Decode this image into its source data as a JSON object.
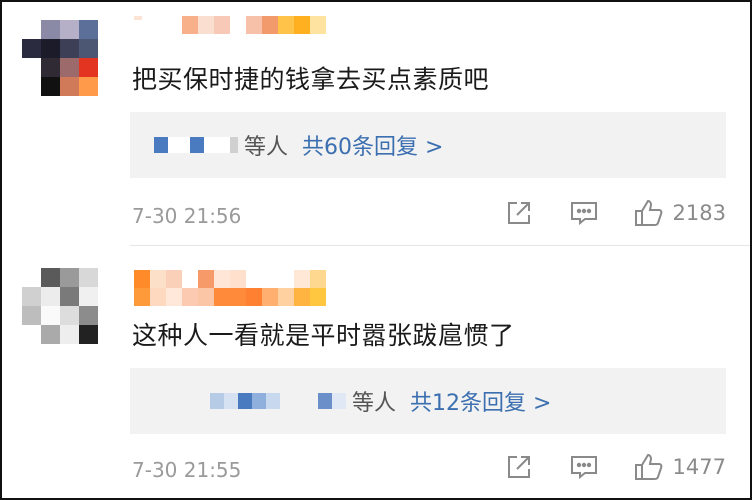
{
  "comments": [
    {
      "text": "把买保时捷的钱拿去买点素质吧",
      "others_label": "等人",
      "replies_label": "共60条回复 >",
      "time": "7-30 21:56",
      "likes": "2183"
    },
    {
      "text": "这种人一看就是平时嚣张跋扈惯了",
      "others_label": "等人",
      "replies_label": "共12条回复 >",
      "time": "7-30 21:55",
      "likes": "1477"
    }
  ],
  "icons": [
    "share-icon",
    "comment-icon",
    "like-icon"
  ],
  "colors": {
    "link": "#3b6fb0",
    "meta": "#9a9a9a",
    "reply_bg": "#f2f2f2"
  }
}
